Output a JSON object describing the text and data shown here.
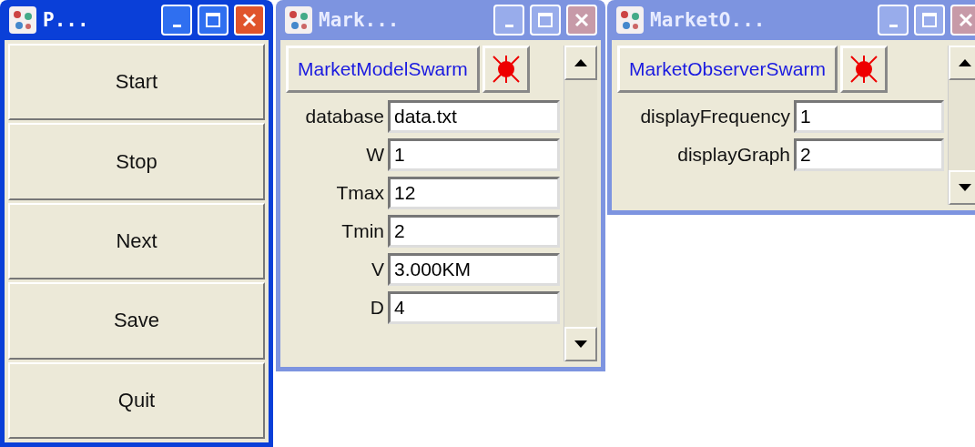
{
  "windows": [
    {
      "kind": "control",
      "title": "P...",
      "active": true,
      "buttons": [
        "Start",
        "Stop",
        "Next",
        "Save",
        "Quit"
      ]
    },
    {
      "kind": "probe",
      "title": "Mark...",
      "active": false,
      "swarm": "MarketModelSwarm",
      "fields": [
        {
          "label": "database",
          "value": "data.txt"
        },
        {
          "label": "W",
          "value": "1"
        },
        {
          "label": "Tmax",
          "value": "12"
        },
        {
          "label": "Tmin",
          "value": "2"
        },
        {
          "label": "V",
          "value": "3.000KM"
        },
        {
          "label": "D",
          "value": "4"
        }
      ]
    },
    {
      "kind": "probe",
      "title": "MarketO...",
      "active": false,
      "swarm": "MarketObserverSwarm",
      "fields": [
        {
          "label": "displayFrequency",
          "value": "1"
        },
        {
          "label": "displayGraph",
          "value": "2"
        }
      ]
    }
  ]
}
